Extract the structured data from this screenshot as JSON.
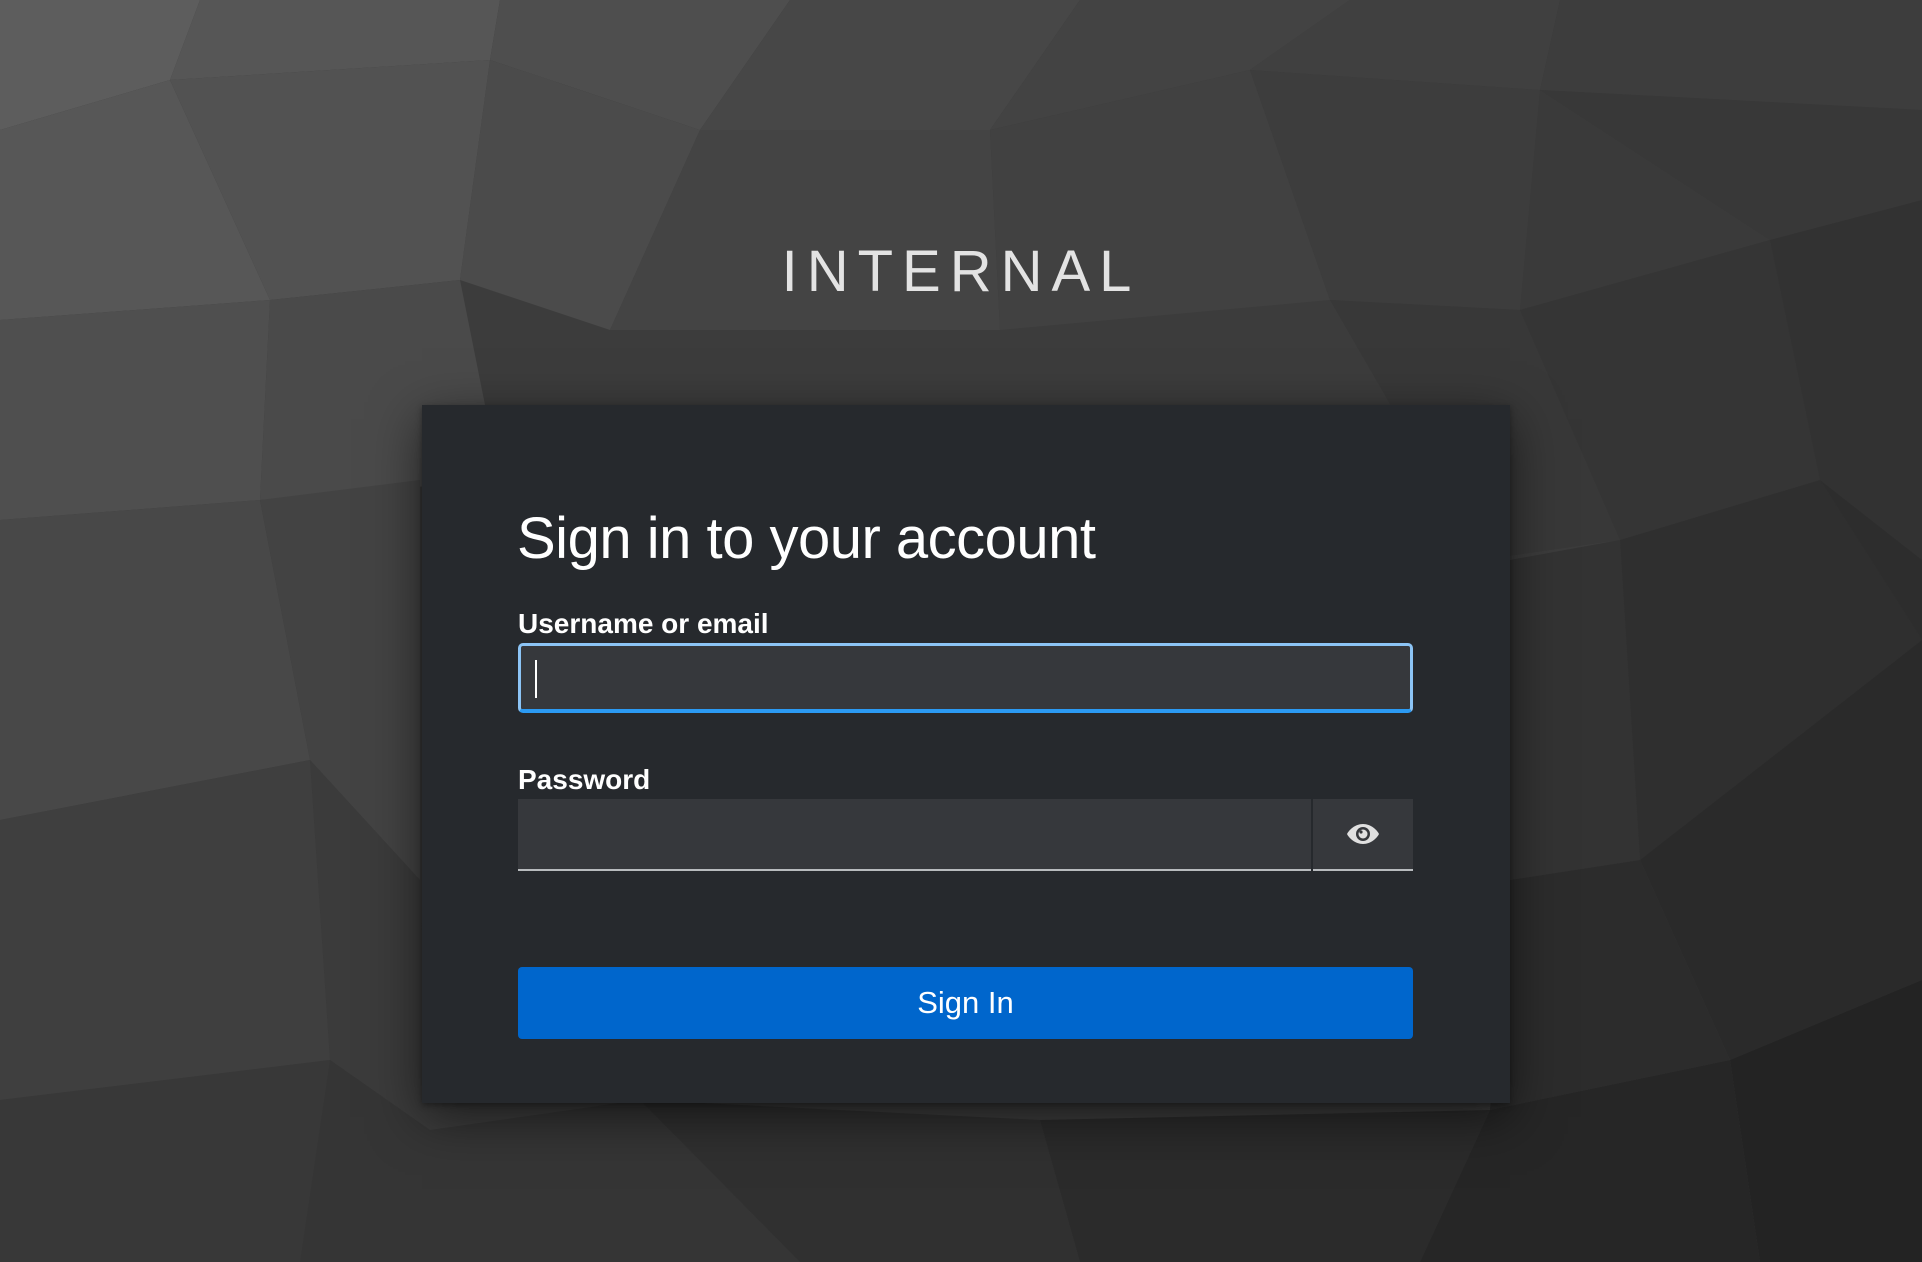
{
  "header": {
    "realm_title": "INTERNAL"
  },
  "login_card": {
    "title": "Sign in to your account",
    "username": {
      "label": "Username or email",
      "value": "",
      "placeholder": ""
    },
    "password": {
      "label": "Password",
      "value": "",
      "placeholder": "",
      "toggle_icon": "eye-icon"
    },
    "submit_label": "Sign In"
  },
  "colors": {
    "background": "#3a3a3a",
    "card_background": "#26292d",
    "input_background": "#36383c",
    "focus_border": "#8cc4f5",
    "focus_underline": "#2b9af3",
    "primary_button": "#0066cc",
    "text_primary": "#ffffff"
  }
}
